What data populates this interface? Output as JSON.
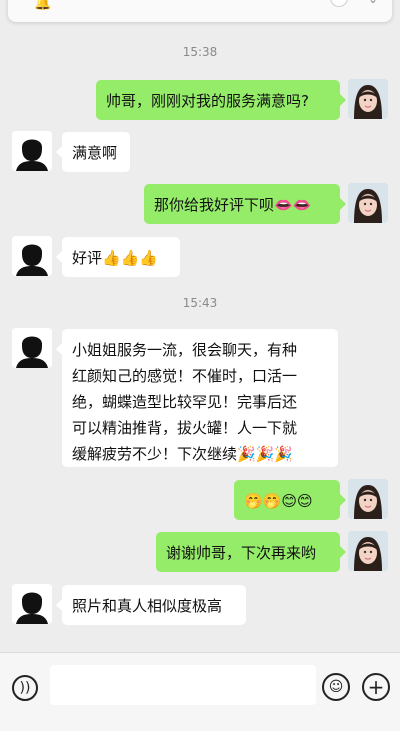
{
  "timestamps": [
    "15:38",
    "15:43"
  ],
  "messages": [
    {
      "side": "out",
      "text": "帅哥，刚刚对我的服务满意吗?"
    },
    {
      "side": "in",
      "text": "满意啊"
    },
    {
      "side": "out",
      "text": "那你给我好评下呗👄👄"
    },
    {
      "side": "in",
      "text": "好评👍👍👍"
    },
    {
      "side": "in",
      "lines": [
        "小姐姐服务一流，很会聊天，有种",
        "红颜知己的感觉！不催时，口活一",
        "绝，蝴蝶造型比较罕见！完事后还",
        "可以精油推背，拔火罐！人一下就",
        "缓解疲劳不少！下次继续🎉🎉🎉"
      ]
    },
    {
      "side": "out",
      "text": "🤭🤭😊😊"
    },
    {
      "side": "out",
      "text": "谢谢帅哥，下次再来哟"
    },
    {
      "side": "in",
      "text": "照片和真人相似度极高"
    }
  ],
  "input": {
    "placeholder": ""
  },
  "icons": {
    "voice": "voice-icon",
    "emoji": "emoji-icon",
    "plus": "plus-icon"
  },
  "colors": {
    "background": "#ededed",
    "outgoing_bubble": "#95ec69",
    "incoming_bubble": "#ffffff"
  }
}
